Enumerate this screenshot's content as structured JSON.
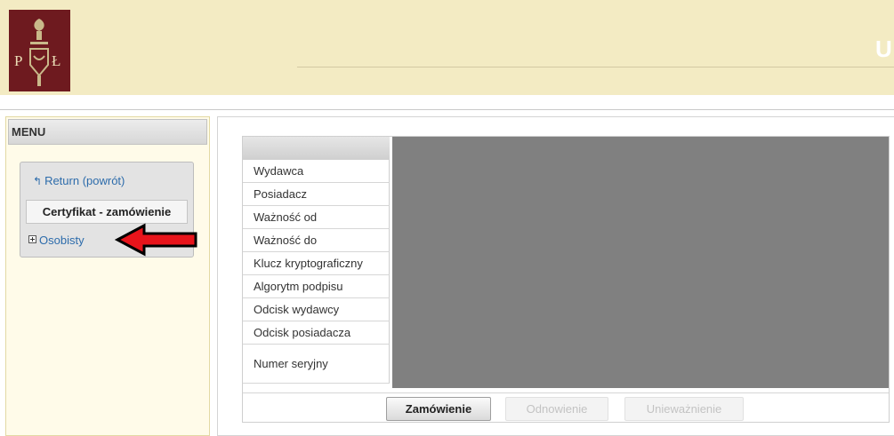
{
  "header": {
    "title": "U"
  },
  "menu": {
    "title": "MENU",
    "return_label": "Return (powrót)",
    "section_label": "Certyfikat - zamówienie",
    "item_label": "Osobisty"
  },
  "certificate": {
    "fields": [
      "Wydawca",
      "Posiadacz",
      "Ważność od",
      "Ważność do",
      "Klucz kryptograficzny",
      "Algorytm podpisu",
      "Odcisk wydawcy",
      "Odcisk posiadacza",
      "Numer seryjny"
    ]
  },
  "actions": {
    "order": "Zamówienie",
    "renew": "Odnowienie",
    "revoke": "Unieważnienie"
  },
  "colors": {
    "header_bg": "#f3ebc3",
    "logo_bg": "#6e1a1f",
    "link": "#2d6cab",
    "arrow": "#e8141b",
    "redacted": "#808080"
  }
}
